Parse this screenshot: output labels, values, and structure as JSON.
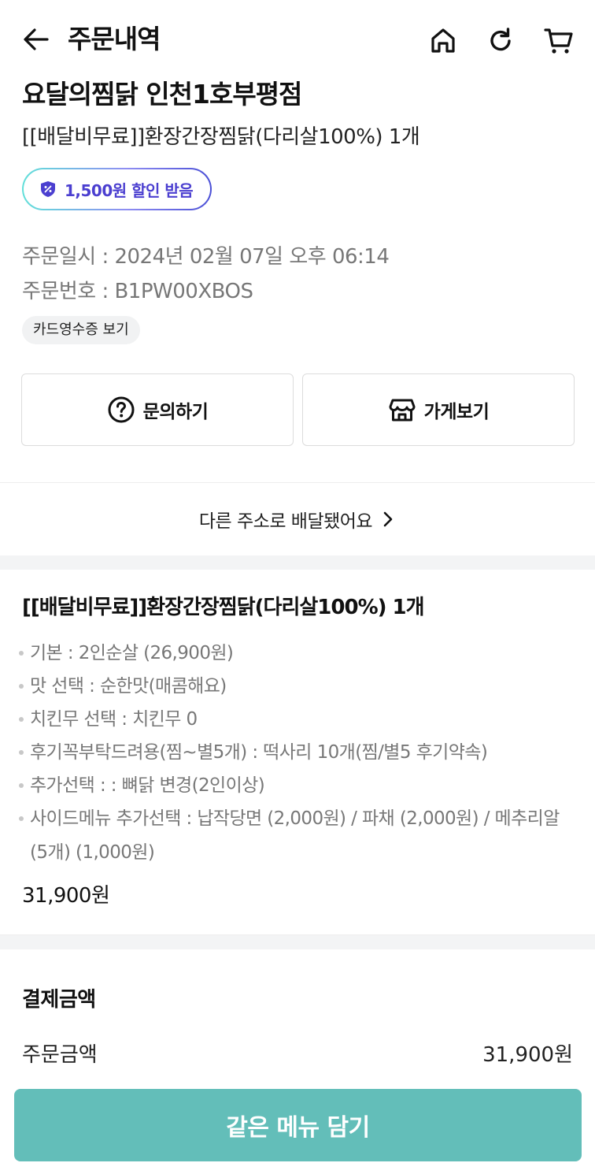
{
  "header": {
    "title": "주문내역"
  },
  "store": {
    "name": "요달의찜닭 인천1호부평점",
    "order_summary": "[[배달비무료]]환장간장찜닭(다리살100%) 1개",
    "discount_badge": "1,500원 할인 받음"
  },
  "order_meta": {
    "date_line": "주문일시 : 2024년 02월 07일 오후 06:14",
    "number_line": "주문번호 : B1PW00XBOS",
    "receipt_label": "카드영수증 보기"
  },
  "actions": {
    "inquiry_label": "문의하기",
    "store_label": "가게보기"
  },
  "address_notice": "다른 주소로 배달됐어요",
  "menu": {
    "title": "[[배달비무료]]환장간장찜닭(다리살100%) 1개",
    "options": [
      "기본 : 2인순살 (26,900원)",
      "맛 선택 : 순한맛(매콤해요)",
      "치킨무 선택 : 치킨무 0",
      "후기꼭부탁드려용(찜~별5개) : 떡사리 10개(찜/별5 후기약속)",
      "추가선택 : : 뼈닭 변경(2인이상)",
      "사이드메뉴 추가선택 : 납작당면 (2,000원) / 파채 (2,000원) / 메추리알 (5개) (1,000원)"
    ],
    "price": "31,900원"
  },
  "payment": {
    "title": "결제금액",
    "order_amount_label": "주문금액",
    "order_amount_value": "31,900원"
  },
  "cta": {
    "label": "같은 메뉴 담기"
  },
  "colors": {
    "accent": "#63beb9",
    "badge_text": "#4b3fd0",
    "muted_text": "#777777"
  }
}
